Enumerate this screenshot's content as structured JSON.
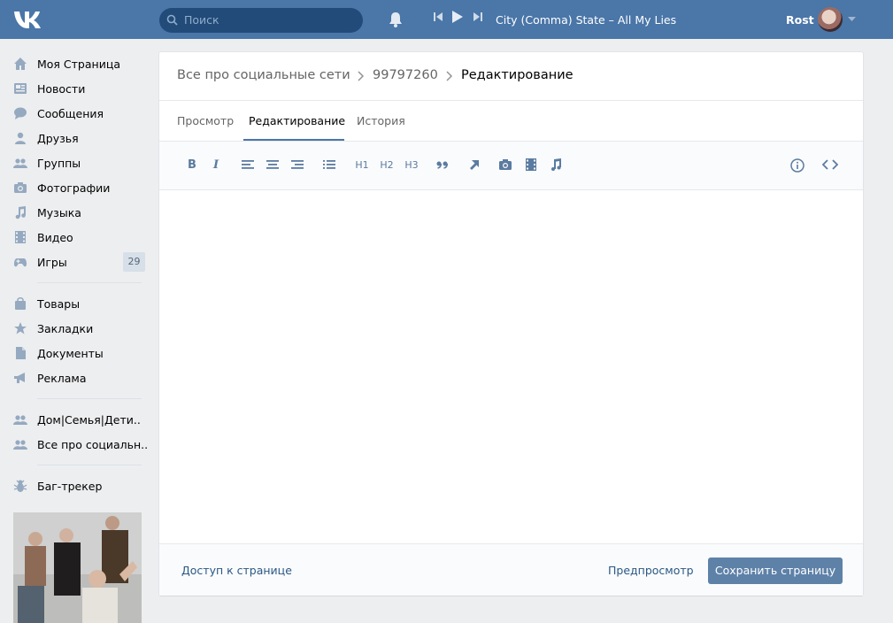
{
  "header": {
    "search_placeholder": "Поиск",
    "now_playing": "City (Comma) State – All My Lies",
    "user_name": "Rost",
    "brand_color": "#4a76a8"
  },
  "sidebar": {
    "items": [
      {
        "label": "Моя Страница",
        "icon": "home-icon"
      },
      {
        "label": "Новости",
        "icon": "news-icon"
      },
      {
        "label": "Сообщения",
        "icon": "messages-icon"
      },
      {
        "label": "Друзья",
        "icon": "friend-icon"
      },
      {
        "label": "Группы",
        "icon": "groups-icon"
      },
      {
        "label": "Фотографии",
        "icon": "camera-icon"
      },
      {
        "label": "Музыка",
        "icon": "music-note-icon"
      },
      {
        "label": "Видео",
        "icon": "film-icon"
      },
      {
        "label": "Игры",
        "icon": "gamepad-icon",
        "badge": "29"
      }
    ],
    "items2": [
      {
        "label": "Товары",
        "icon": "bag-icon"
      },
      {
        "label": "Закладки",
        "icon": "star-icon"
      },
      {
        "label": "Документы",
        "icon": "document-icon"
      },
      {
        "label": "Реклама",
        "icon": "megaphone-icon"
      }
    ],
    "items3": [
      {
        "label": "Дом|Семья|Дети..",
        "icon": "groups-icon"
      },
      {
        "label": "Все про социальн..",
        "icon": "groups-icon"
      }
    ],
    "items4": [
      {
        "label": "Баг-трекер",
        "icon": "bug-icon"
      }
    ]
  },
  "breadcrumb": {
    "parts": [
      "Все про социальные сети",
      "99797260",
      "Редактирование"
    ]
  },
  "tabs": [
    "Просмотр",
    "Редактирование",
    "История"
  ],
  "toolbar": {
    "bold": "B",
    "italic": "I",
    "h1": "H1",
    "h2": "H2",
    "h3": "H3"
  },
  "footer": {
    "access_label": "Доступ к странице",
    "preview_label": "Предпросмотр",
    "save_label": "Сохранить страницу"
  }
}
